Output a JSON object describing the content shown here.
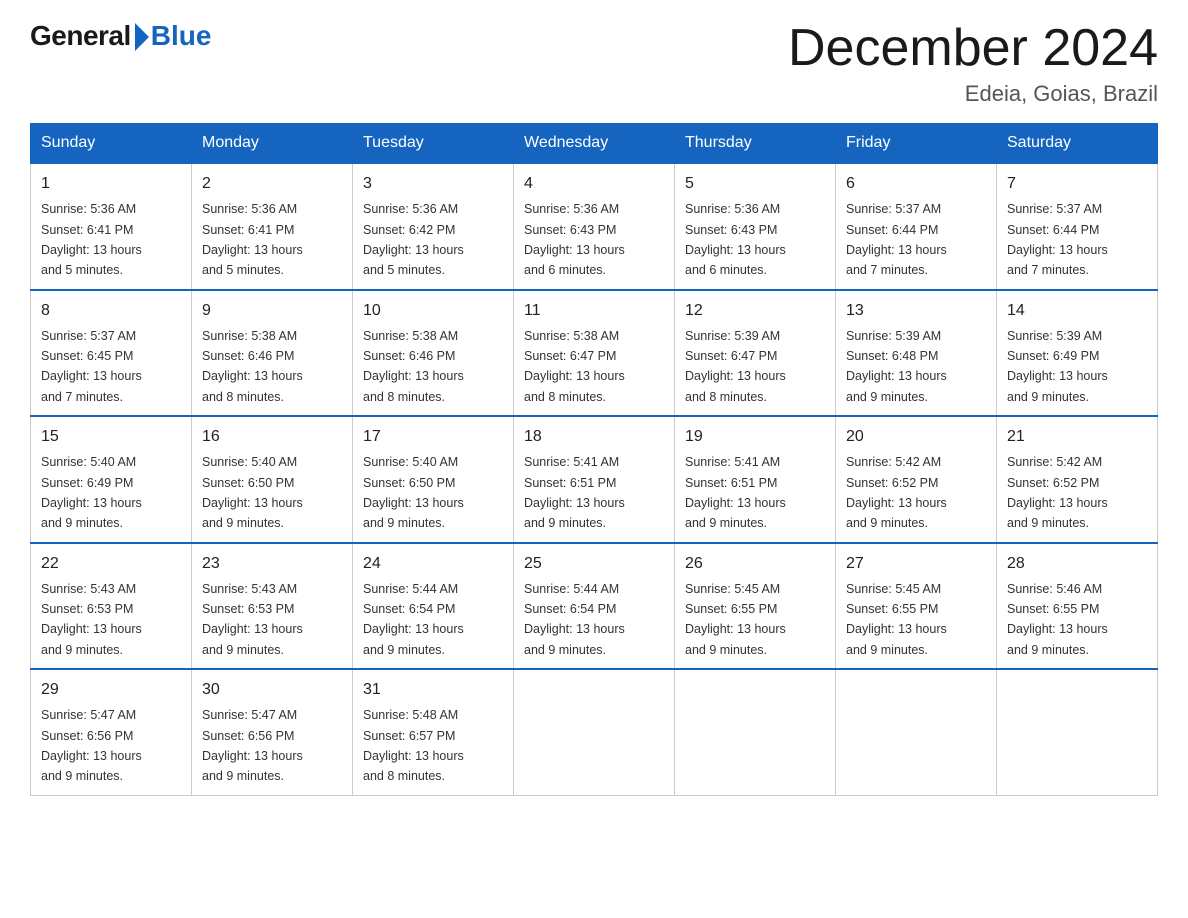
{
  "header": {
    "logo_general": "General",
    "logo_blue": "Blue",
    "month_title": "December 2024",
    "location": "Edeia, Goias, Brazil"
  },
  "days_of_week": [
    "Sunday",
    "Monday",
    "Tuesday",
    "Wednesday",
    "Thursday",
    "Friday",
    "Saturday"
  ],
  "weeks": [
    [
      {
        "day": "1",
        "sunrise": "5:36 AM",
        "sunset": "6:41 PM",
        "daylight": "13 hours and 5 minutes."
      },
      {
        "day": "2",
        "sunrise": "5:36 AM",
        "sunset": "6:41 PM",
        "daylight": "13 hours and 5 minutes."
      },
      {
        "day": "3",
        "sunrise": "5:36 AM",
        "sunset": "6:42 PM",
        "daylight": "13 hours and 5 minutes."
      },
      {
        "day": "4",
        "sunrise": "5:36 AM",
        "sunset": "6:43 PM",
        "daylight": "13 hours and 6 minutes."
      },
      {
        "day": "5",
        "sunrise": "5:36 AM",
        "sunset": "6:43 PM",
        "daylight": "13 hours and 6 minutes."
      },
      {
        "day": "6",
        "sunrise": "5:37 AM",
        "sunset": "6:44 PM",
        "daylight": "13 hours and 7 minutes."
      },
      {
        "day": "7",
        "sunrise": "5:37 AM",
        "sunset": "6:44 PM",
        "daylight": "13 hours and 7 minutes."
      }
    ],
    [
      {
        "day": "8",
        "sunrise": "5:37 AM",
        "sunset": "6:45 PM",
        "daylight": "13 hours and 7 minutes."
      },
      {
        "day": "9",
        "sunrise": "5:38 AM",
        "sunset": "6:46 PM",
        "daylight": "13 hours and 8 minutes."
      },
      {
        "day": "10",
        "sunrise": "5:38 AM",
        "sunset": "6:46 PM",
        "daylight": "13 hours and 8 minutes."
      },
      {
        "day": "11",
        "sunrise": "5:38 AM",
        "sunset": "6:47 PM",
        "daylight": "13 hours and 8 minutes."
      },
      {
        "day": "12",
        "sunrise": "5:39 AM",
        "sunset": "6:47 PM",
        "daylight": "13 hours and 8 minutes."
      },
      {
        "day": "13",
        "sunrise": "5:39 AM",
        "sunset": "6:48 PM",
        "daylight": "13 hours and 9 minutes."
      },
      {
        "day": "14",
        "sunrise": "5:39 AM",
        "sunset": "6:49 PM",
        "daylight": "13 hours and 9 minutes."
      }
    ],
    [
      {
        "day": "15",
        "sunrise": "5:40 AM",
        "sunset": "6:49 PM",
        "daylight": "13 hours and 9 minutes."
      },
      {
        "day": "16",
        "sunrise": "5:40 AM",
        "sunset": "6:50 PM",
        "daylight": "13 hours and 9 minutes."
      },
      {
        "day": "17",
        "sunrise": "5:40 AM",
        "sunset": "6:50 PM",
        "daylight": "13 hours and 9 minutes."
      },
      {
        "day": "18",
        "sunrise": "5:41 AM",
        "sunset": "6:51 PM",
        "daylight": "13 hours and 9 minutes."
      },
      {
        "day": "19",
        "sunrise": "5:41 AM",
        "sunset": "6:51 PM",
        "daylight": "13 hours and 9 minutes."
      },
      {
        "day": "20",
        "sunrise": "5:42 AM",
        "sunset": "6:52 PM",
        "daylight": "13 hours and 9 minutes."
      },
      {
        "day": "21",
        "sunrise": "5:42 AM",
        "sunset": "6:52 PM",
        "daylight": "13 hours and 9 minutes."
      }
    ],
    [
      {
        "day": "22",
        "sunrise": "5:43 AM",
        "sunset": "6:53 PM",
        "daylight": "13 hours and 9 minutes."
      },
      {
        "day": "23",
        "sunrise": "5:43 AM",
        "sunset": "6:53 PM",
        "daylight": "13 hours and 9 minutes."
      },
      {
        "day": "24",
        "sunrise": "5:44 AM",
        "sunset": "6:54 PM",
        "daylight": "13 hours and 9 minutes."
      },
      {
        "day": "25",
        "sunrise": "5:44 AM",
        "sunset": "6:54 PM",
        "daylight": "13 hours and 9 minutes."
      },
      {
        "day": "26",
        "sunrise": "5:45 AM",
        "sunset": "6:55 PM",
        "daylight": "13 hours and 9 minutes."
      },
      {
        "day": "27",
        "sunrise": "5:45 AM",
        "sunset": "6:55 PM",
        "daylight": "13 hours and 9 minutes."
      },
      {
        "day": "28",
        "sunrise": "5:46 AM",
        "sunset": "6:55 PM",
        "daylight": "13 hours and 9 minutes."
      }
    ],
    [
      {
        "day": "29",
        "sunrise": "5:47 AM",
        "sunset": "6:56 PM",
        "daylight": "13 hours and 9 minutes."
      },
      {
        "day": "30",
        "sunrise": "5:47 AM",
        "sunset": "6:56 PM",
        "daylight": "13 hours and 9 minutes."
      },
      {
        "day": "31",
        "sunrise": "5:48 AM",
        "sunset": "6:57 PM",
        "daylight": "13 hours and 8 minutes."
      },
      null,
      null,
      null,
      null
    ]
  ],
  "labels": {
    "sunrise": "Sunrise:",
    "sunset": "Sunset:",
    "daylight": "Daylight:"
  }
}
